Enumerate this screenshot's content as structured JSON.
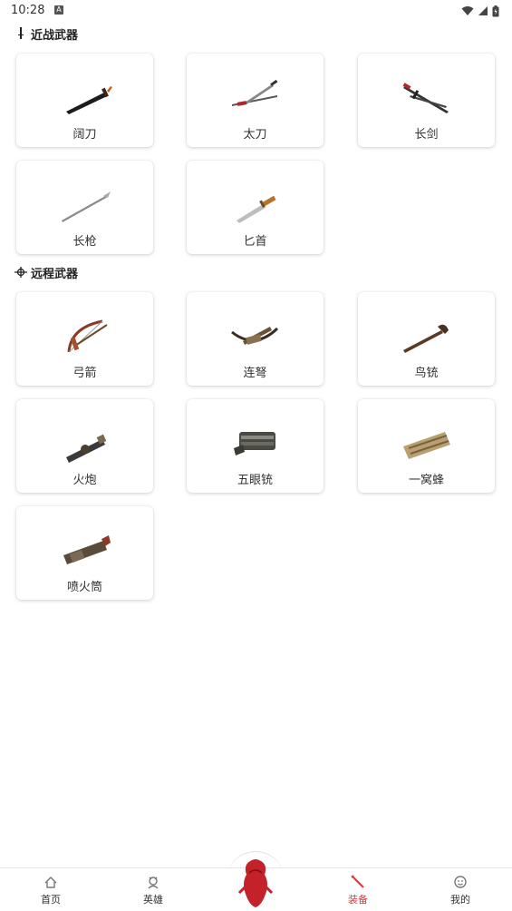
{
  "status_bar": {
    "time": "10:28",
    "notification_icon": "A"
  },
  "sections": [
    {
      "title": "近战武器",
      "icon": "sword-icon",
      "items": [
        {
          "label": "阔刀",
          "icon": "broadsword-icon"
        },
        {
          "label": "太刀",
          "icon": "tachi-icon"
        },
        {
          "label": "长剑",
          "icon": "longsword-icon"
        },
        {
          "label": "长枪",
          "icon": "spear-icon"
        },
        {
          "label": "匕首",
          "icon": "dagger-icon"
        }
      ]
    },
    {
      "title": "远程武器",
      "icon": "crosshair-icon",
      "items": [
        {
          "label": "弓箭",
          "icon": "bow-icon"
        },
        {
          "label": "连弩",
          "icon": "crossbow-icon"
        },
        {
          "label": "鸟铳",
          "icon": "musket-icon"
        },
        {
          "label": "火炮",
          "icon": "cannon-icon"
        },
        {
          "label": "五眼铳",
          "icon": "five-barrel-gun-icon"
        },
        {
          "label": "一窝蜂",
          "icon": "rocket-launcher-icon"
        },
        {
          "label": "喷火筒",
          "icon": "flamethrower-icon"
        }
      ]
    }
  ],
  "bottom_nav": {
    "items": [
      {
        "label": "首页",
        "icon": "home-icon",
        "active": false
      },
      {
        "label": "英雄",
        "icon": "hero-icon",
        "active": false
      },
      {
        "label": "装备",
        "icon": "equipment-icon",
        "active": true
      },
      {
        "label": "我的",
        "icon": "profile-icon",
        "active": false
      }
    ],
    "center_icon": "mascot-icon"
  },
  "colors": {
    "accent": "#d9383f",
    "background": "#ffffff",
    "text": "#222222"
  }
}
